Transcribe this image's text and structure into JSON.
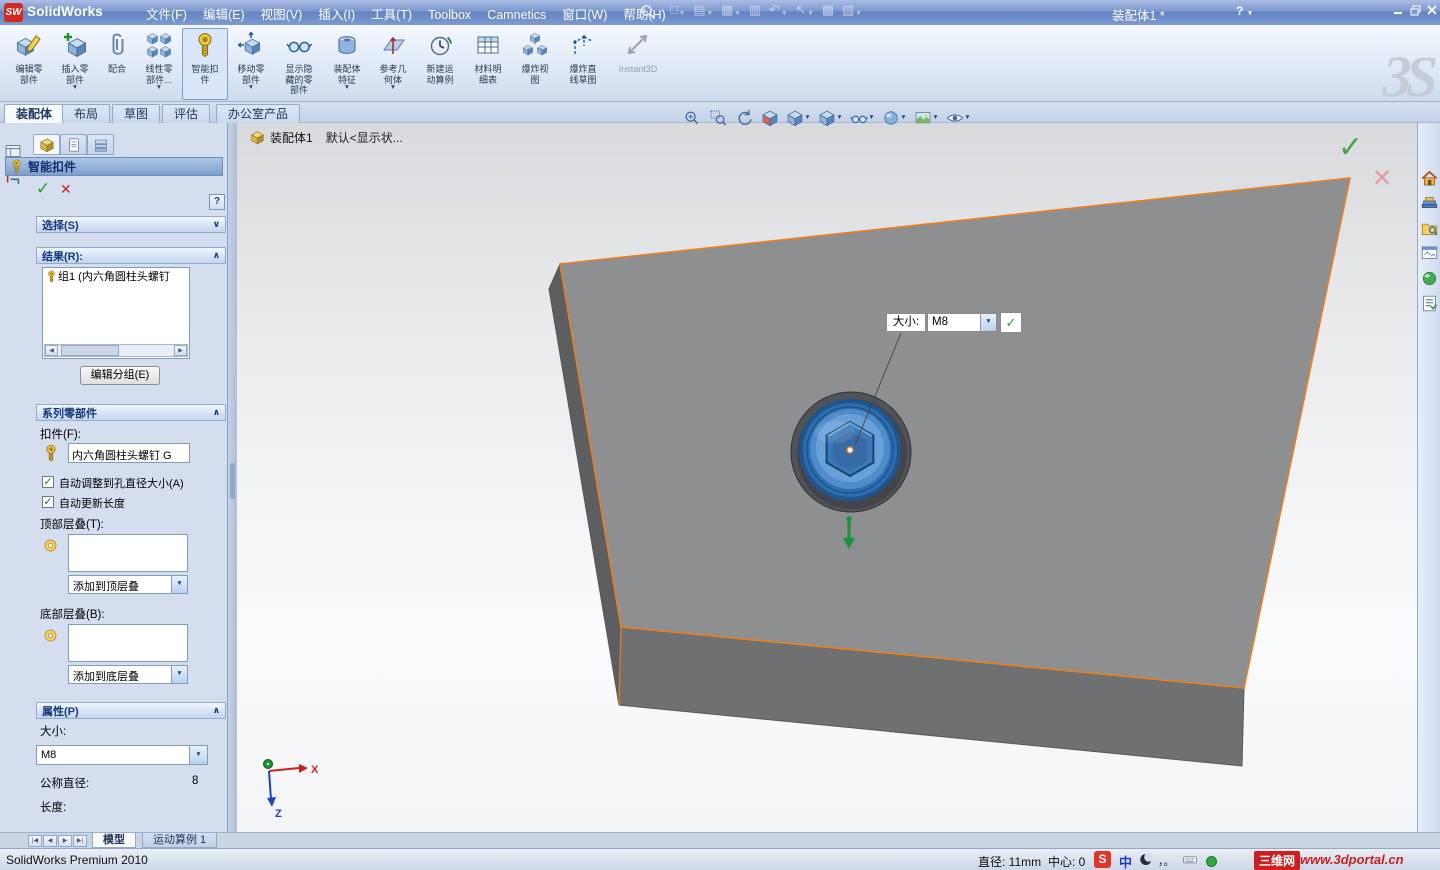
{
  "glyphs": {
    "check": "✓",
    "cross": "✕",
    "caret": "▼",
    "collapse": "∨",
    "expand": "∧",
    "scroll_left": "◀",
    "scroll_right": "▶",
    "tab_first": "|◀",
    "tab_prev": "◀",
    "tab_next": "▶",
    "tab_last": "▶|",
    "question": "?"
  },
  "titlebar": {
    "logo_badge": "SW",
    "logo_text": "SolidWorks",
    "menus": [
      "文件(F)",
      "编辑(E)",
      "视图(V)",
      "插入(I)",
      "工具(T)",
      "Toolbox",
      "Camnetics",
      "窗口(W)",
      "帮助(H)"
    ],
    "qat": [
      {
        "name": "new-document",
        "glyph": "□"
      },
      {
        "name": "open-document",
        "glyph": "▤"
      },
      {
        "name": "save",
        "glyph": "▦"
      },
      {
        "name": "print",
        "glyph": "▥"
      },
      {
        "name": "undo",
        "glyph": "↶"
      },
      {
        "name": "select",
        "glyph": "↖"
      },
      {
        "name": "rebuild",
        "glyph": "▩"
      },
      {
        "name": "options",
        "glyph": "▧"
      }
    ],
    "document_title": "装配体1 *"
  },
  "command_manager": {
    "buttons": [
      {
        "label": "编辑零\n部件"
      },
      {
        "label": "插入零\n部件",
        "dropdown": true
      },
      {
        "label": "配合"
      },
      {
        "label": "线性零\n部件...",
        "dropdown": true
      },
      {
        "label": "智能扣\n件",
        "active": true
      },
      {
        "label": "移动零\n部件",
        "dropdown": true
      },
      {
        "label": "显示隐\n藏的零\n部件"
      },
      {
        "label": "装配体\n特征",
        "dropdown": true
      },
      {
        "label": "参考几\n何体",
        "dropdown": true
      },
      {
        "label": "新建运\n动算例"
      },
      {
        "label": "材料明\n细表"
      },
      {
        "label": "爆炸视\n图"
      },
      {
        "label": "爆炸直\n线草图"
      },
      {
        "label": "Instant3D",
        "disabled": true
      }
    ],
    "watermark": "3S"
  },
  "ribbon_tabs": {
    "items": [
      "装配体",
      "布局",
      "草图",
      "评估",
      "办公室产品"
    ],
    "active": "装配体"
  },
  "property_manager": {
    "title": "智能扣件",
    "sections": {
      "selection": {
        "title": "选择(S)"
      },
      "results": {
        "title": "结果(R):",
        "item": "组1 (内六角圆柱头螺钉",
        "edit_group_button": "编辑分组(E)"
      },
      "series": {
        "title": "系列零部件",
        "fastener_label": "扣件(F):",
        "fastener_value": "内六角圆柱头螺钉 G",
        "auto_hole_size": "自动调整到孔直径大小(A)",
        "auto_length": "自动更新长度",
        "top_stack_label": "顶部层叠(T):",
        "add_top_stack": "添加到顶层叠",
        "bottom_stack_label": "底部层叠(B):",
        "add_bottom_stack": "添加到底层叠"
      },
      "properties": {
        "title": "属性(P)",
        "size_label": "大小:",
        "size_value": "M8",
        "diameter_label": "公称直径:",
        "diameter_value": "8",
        "length_label": "长度:"
      }
    }
  },
  "viewport": {
    "breadcrumb_title": "装配体1",
    "breadcrumb_state": "默认<显示状...",
    "callout_label": "大小:",
    "callout_value": "M8",
    "axis_x": "X",
    "axis_z": "Z",
    "headsup_icons": [
      "zoom-to-fit",
      "zoom-to-area",
      "previous-view",
      "section-view",
      "view-orientation",
      "display-style",
      "hide-show-items",
      "edit-appearance",
      "apply-scene",
      "view-settings"
    ],
    "taskpane_icons": [
      "solidworks-resources",
      "design-library",
      "file-explorer",
      "view-palette",
      "appearances",
      "custom-properties"
    ]
  },
  "model_tabs": {
    "items": [
      "模型",
      "运动算例 1"
    ],
    "active": "模型"
  },
  "status_bar": {
    "app_version": "SolidWorks Premium 2010",
    "diameter": "直径: 11mm",
    "center": "中心: 0",
    "ime_badge": "S",
    "ime_lang": "中",
    "ime_punct": "，。",
    "site_badge": "三维网",
    "site_url": "www.3dportal.cn"
  }
}
